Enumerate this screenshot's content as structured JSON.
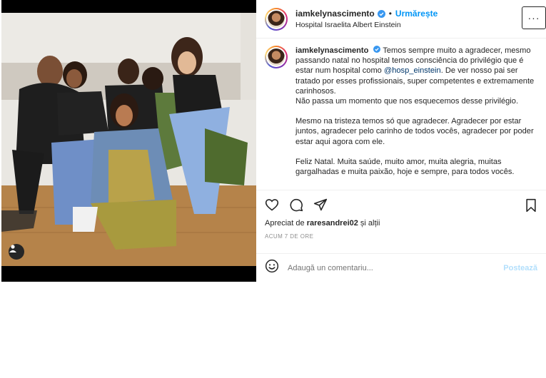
{
  "header": {
    "username": "iamkelynascimento",
    "separator": "•",
    "follow_label": "Urmărește",
    "location": "Hospital Israelita Albert Einstein",
    "more_label": "···"
  },
  "caption": {
    "username": "iamkelynascimento",
    "p1": "Temos sempre muito a agradecer, mesmo passando natal no hospital temos consciência do privilégio que é estar num hospital como ",
    "mention": "@hosp_einstein",
    "p1_end": ". De ver nosso pai ser tratado por esses profissionais, super competentes e extremamente carinhosos.",
    "p2": "Não passa um momento que nos esquecemos desse privilégio.",
    "p3": "Mesmo na tristeza temos só que agradecer. Agradecer por estar juntos, agradecer pelo carinho de todos vocês, agradecer por poder estar aqui agora com ele.",
    "p4": "Feliz Natal. Muita saúde, muito amor, muita alegria, muitas gargalhadas e muita paixão, hoje e sempre, para todos vocês."
  },
  "likes": {
    "prefix": "Apreciat de ",
    "user": "raresandrei02",
    "suffix": " și alții"
  },
  "timestamp": "ACUM 7 DE ORE",
  "comment": {
    "placeholder": "Adaugă un comentariu...",
    "post_label": "Postează"
  },
  "icons": {
    "verified": "verified-badge-icon",
    "like": "heart-icon",
    "comment": "comment-icon",
    "share": "paper-plane-icon",
    "save": "bookmark-icon",
    "emoji": "smiley-icon",
    "tag": "user-tag-icon"
  },
  "colors": {
    "accent": "#0095f6",
    "post_disabled": "#b2dffc",
    "mention": "#00376b"
  }
}
